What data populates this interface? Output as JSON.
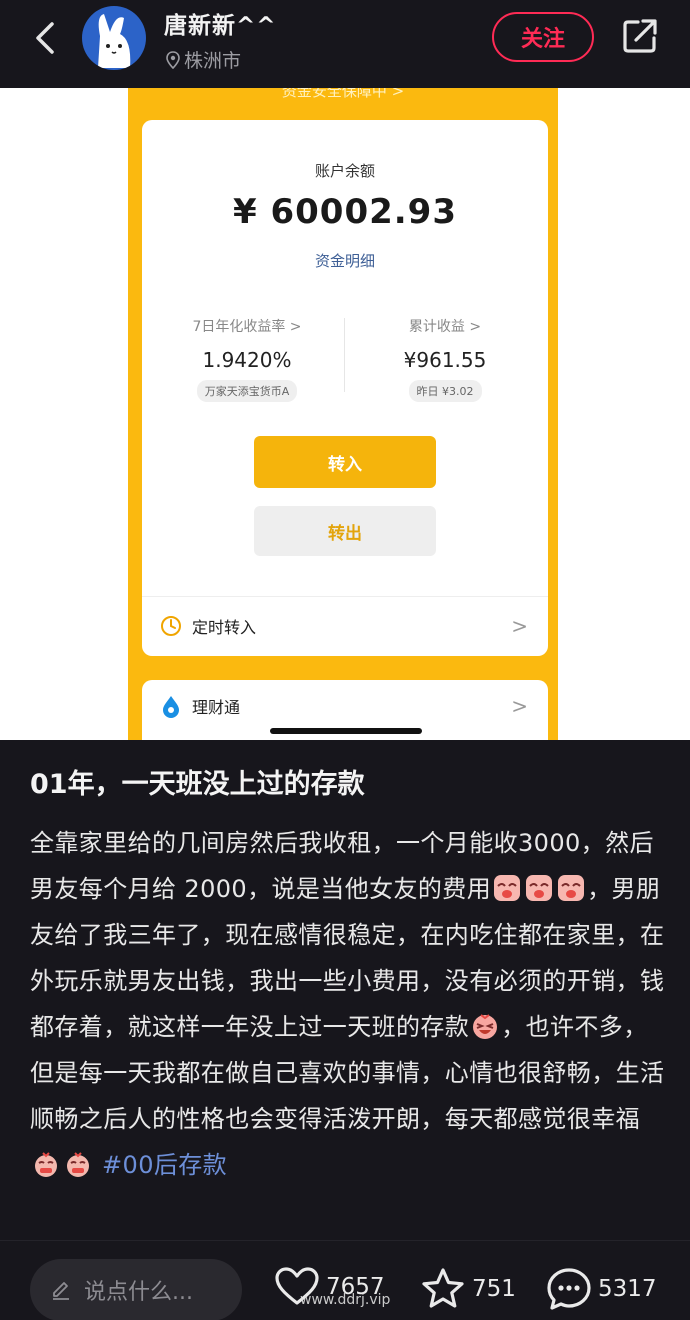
{
  "header": {
    "user_name": "唐新新^^",
    "location": "株洲市",
    "follow_label": "关注"
  },
  "screenshot": {
    "safety_banner": "资金安全保障中 >",
    "balance_label": "账户余额",
    "balance_value": "¥ 60002.93",
    "detail_link": "资金明细",
    "yield_label": "7日年化收益率 >",
    "yield_value": "1.9420%",
    "fund_name": "万家天添宝货币A",
    "earnings_label": "累计收益 >",
    "earnings_value": "¥961.55",
    "yesterday": "昨日 ¥3.02",
    "transfer_in": "转入",
    "transfer_out": "转出",
    "scheduled_label": "定时转入",
    "licaitong_label": "理财通",
    "chevron": ">"
  },
  "post": {
    "title": "01年，一天班没上过的存款",
    "body_1": "全靠家里给的几间房然后我收租，一个月能收3000，然后男友每个月给 2000，说是当他女友的费用",
    "body_2": "，男朋友给了我三年了，现在感情很稳定，在内吃住都在家里，在外玩乐就男友出钱，我出一些小费用，没有必须的开销，钱都存着，就这样一年没上过一天班的存款",
    "body_3": "，也许不多，但是每一天我都在做自己喜欢的事情，心情也很舒畅，生活顺畅之后人的性格也会变得活泼开朗，每天都感觉很幸福",
    "hashtag": "#00后存款"
  },
  "bottom": {
    "comment_placeholder": "说点什么...",
    "likes": "7657",
    "stars": "751",
    "comments": "5317",
    "watermark": "www.ddrj.vip"
  },
  "colors": {
    "accent_red": "#ff2b55",
    "wallet_yellow": "#fbb90f",
    "hashtag_blue": "#6d8fd8"
  },
  "icons": [
    "back-icon",
    "avatar",
    "location-pin-icon",
    "share-icon",
    "clock-icon",
    "licaitong-icon",
    "pencil-icon",
    "heart-icon",
    "star-icon",
    "comment-icon"
  ]
}
